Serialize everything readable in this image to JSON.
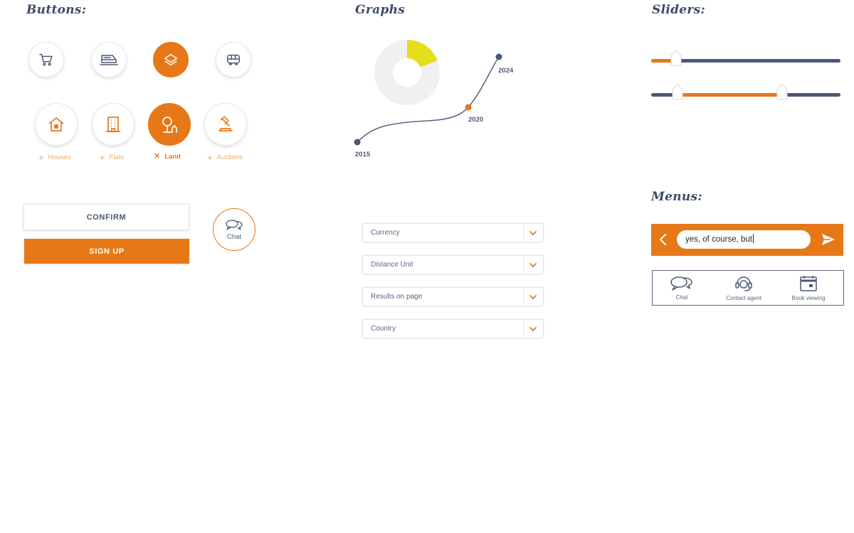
{
  "sections": {
    "buttons": "Buttons:",
    "graphs": "Graphs",
    "sliders": "Sliders:",
    "menus": "Menus:"
  },
  "icon_buttons": [
    {
      "icon": "shopping-cart-icon",
      "active": false
    },
    {
      "icon": "train-icon",
      "active": false
    },
    {
      "icon": "education-cap-icon",
      "active": true
    },
    {
      "icon": "bus-icon",
      "active": false
    }
  ],
  "categories": [
    {
      "label": "Houses",
      "icon": "house-icon",
      "mark": "+",
      "active": false
    },
    {
      "label": "Flats",
      "icon": "building-icon",
      "mark": "+",
      "active": false
    },
    {
      "label": "Land",
      "icon": "tree-icon",
      "mark": "✕",
      "active": true
    },
    {
      "label": "Auctions",
      "icon": "gavel-icon",
      "mark": "+",
      "active": false
    }
  ],
  "actions": {
    "confirm": "CONFIRM",
    "sign_up": "SIGN UP",
    "chat": "Chat"
  },
  "chart_data": {
    "type": "line",
    "x": [
      "2015",
      "2020",
      "2024"
    ],
    "points": [
      {
        "label": "2015",
        "color": "#4b5876"
      },
      {
        "label": "2020",
        "color": "#e67817"
      },
      {
        "label": "2024",
        "color": "#4b5876"
      }
    ],
    "donut": {
      "highlight_fraction": 0.19,
      "highlight_color": "#e5de1a",
      "base_color": "#f0f0f0"
    },
    "line_color": "#5b6684"
  },
  "selects": [
    {
      "label": "Currency"
    },
    {
      "label": "Distance Unit"
    },
    {
      "label": "Results on page"
    },
    {
      "label": "Country"
    }
  ],
  "sliders": [
    {
      "type": "single",
      "value": 0.13
    },
    {
      "type": "range",
      "low": 0.14,
      "high": 0.69
    }
  ],
  "chat_input": {
    "value": "yes, of course, but"
  },
  "action_menu": [
    {
      "label": "Chat",
      "icon": "chat-bubbles-icon"
    },
    {
      "label": "Contact agent",
      "icon": "headset-icon"
    },
    {
      "label": "Book viewing",
      "icon": "calendar-icon"
    }
  ],
  "colors": {
    "accent": "#e67817",
    "navy": "#4b5876",
    "highlight": "#e5de1a"
  }
}
